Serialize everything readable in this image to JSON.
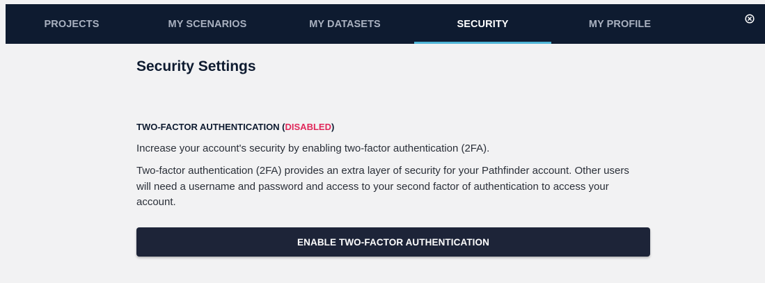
{
  "nav": {
    "tabs": [
      {
        "label": "PROJECTS"
      },
      {
        "label": "MY SCENARIOS"
      },
      {
        "label": "MY DATASETS"
      },
      {
        "label": "SECURITY",
        "active": true
      },
      {
        "label": "MY PROFILE"
      }
    ],
    "close_icon": "close-circle-icon"
  },
  "main": {
    "heading": "Security Settings",
    "twofa": {
      "title_prefix": "TWO-FACTOR AUTHENTICATION (",
      "status": "DISABLED",
      "title_suffix": ")",
      "description_1": "Increase your account's security by enabling two-factor authentication (2FA).",
      "description_2": "Two-factor authentication (2FA) provides an extra layer of security for your Pathfinder account. Other users will need a username and password and access to your second factor of authentication to access your account.",
      "button_label": "ENABLE TWO-FACTOR AUTHENTICATION"
    }
  },
  "colors": {
    "navbar_bg": "#0e1b30",
    "active_tab_underline": "#4fb6d8",
    "disabled_status": "#e0285a",
    "button_bg": "#1d2438",
    "page_bg": "#f2f2f3"
  }
}
